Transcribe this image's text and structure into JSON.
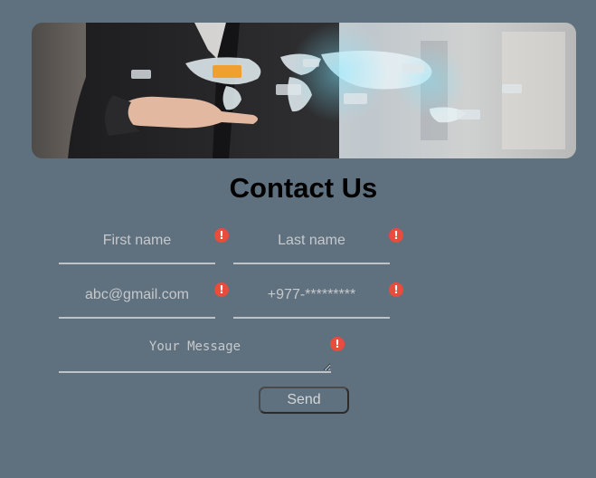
{
  "banner": {
    "image_name": "business-hand-world-map-image"
  },
  "heading": {
    "title": "Contact Us"
  },
  "form": {
    "first_name_placeholder": "First name",
    "last_name_placeholder": "Last name",
    "email_placeholder": "abc@gmail.com",
    "phone_placeholder": "+977-*********",
    "message_placeholder": "Your Message",
    "send_label": "Send",
    "error_icon": "exclamation-icon",
    "error_glyph": "!"
  },
  "colors": {
    "background": "#5f707f",
    "error": "#e84c3d",
    "field_line": "#bfc3c5"
  }
}
